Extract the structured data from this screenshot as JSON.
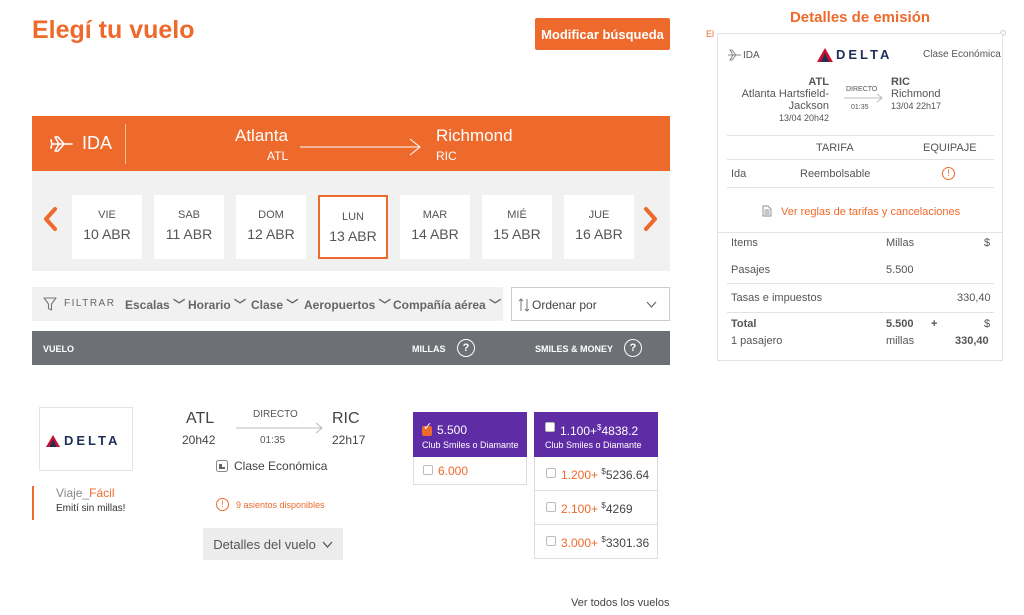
{
  "page": {
    "title": "Elegí tu vuelo",
    "modify_label": "Modificar búsqueda"
  },
  "banner": {
    "direction": "IDA",
    "from_city": "Atlanta",
    "from_code": "ATL",
    "to_city": "Richmond",
    "to_code": "RIC"
  },
  "dates": [
    {
      "dow": "VIE",
      "day": "10 ABR"
    },
    {
      "dow": "SAB",
      "day": "11 ABR"
    },
    {
      "dow": "DOM",
      "day": "12 ABR"
    },
    {
      "dow": "LUN",
      "day": "13 ABR"
    },
    {
      "dow": "MAR",
      "day": "14 ABR"
    },
    {
      "dow": "MIÉ",
      "day": "15 ABR"
    },
    {
      "dow": "JUE",
      "day": "16 ABR"
    }
  ],
  "selected_date_index": 3,
  "filters": {
    "label": "FILTRAR",
    "items": [
      "Escalas",
      "Horario",
      "Clase",
      "Aeropuertos",
      "Compañía aérea"
    ],
    "sort_label": "Ordenar por"
  },
  "table_header": {
    "flight": "VUELO",
    "miles": "MILLAS",
    "smiles_money": "SMILES & MONEY",
    "help": "?"
  },
  "flight": {
    "airline": "DELTA",
    "from_code": "ATL",
    "from_time": "20h42",
    "to_code": "RIC",
    "to_time": "22h17",
    "stops": "DIRECTO",
    "duration": "01:35",
    "cabin": "Clase Económica",
    "seats": "9 asientos disponibles",
    "details_label": "Detalles del vuelo",
    "promo_title_a": "Viaje",
    "promo_title_b": "Fácil",
    "promo_sub": "Emití sin millas!"
  },
  "miles_options": {
    "head_value": "5.500",
    "head_sub": "Club Smiles o Diamante",
    "rows": [
      "6.000"
    ]
  },
  "money_options": {
    "head_miles": "1.100+",
    "head_currency": "$",
    "head_money": "4838.2",
    "head_sub": "Club Smiles o Diamante",
    "rows": [
      {
        "miles": "1.200+",
        "currency": "$",
        "money": "5236.64"
      },
      {
        "miles": "2.100+",
        "currency": "$",
        "money": "4269"
      },
      {
        "miles": "3.000+",
        "currency": "$",
        "money": "3301.36"
      }
    ]
  },
  "footer": {
    "all_flights": "Ver todos los vuelos"
  },
  "panel": {
    "title": "Detalles de emisión",
    "edge_text": "El",
    "direction": "IDA",
    "airline": "DELTA",
    "cabin": "Clase Económica",
    "from_code": "ATL",
    "from_name_1": "Atlanta Hartsfield-",
    "from_name_2": "Jackson",
    "from_date": "13/04 20h42",
    "to_code": "RIC",
    "to_name": "Richmond",
    "to_date": "13/04 22h17",
    "stops": "DIRECTO",
    "duration": "01:35",
    "fare_header": "TARIFA",
    "baggage_header": "EQUIPAJE",
    "fare_leg": "Ida",
    "fare_type": "Reembolsable",
    "rules_link": "Ver reglas de tarifas y cancelaciones",
    "items_header": "Items",
    "miles_header": "Millas",
    "money_header": "$",
    "rows": [
      {
        "label": "Pasajes",
        "miles": "5.500",
        "money": ""
      },
      {
        "label": "Tasas e impuestos",
        "miles": "",
        "money": "330,40"
      }
    ],
    "total_label": "Total",
    "total_miles": "5.500",
    "plus": "+",
    "total_currency": "$",
    "passengers": "1 pasajero",
    "miles_word": "millas",
    "total_money": "330,40"
  },
  "colors": {
    "accent": "#ee6a2c",
    "purple": "#5e2ca5",
    "header_gray": "#6d7075",
    "strip_gray": "#f1f1f1",
    "delta_red": "#c8102e",
    "delta_navy": "#1e2f5a"
  }
}
